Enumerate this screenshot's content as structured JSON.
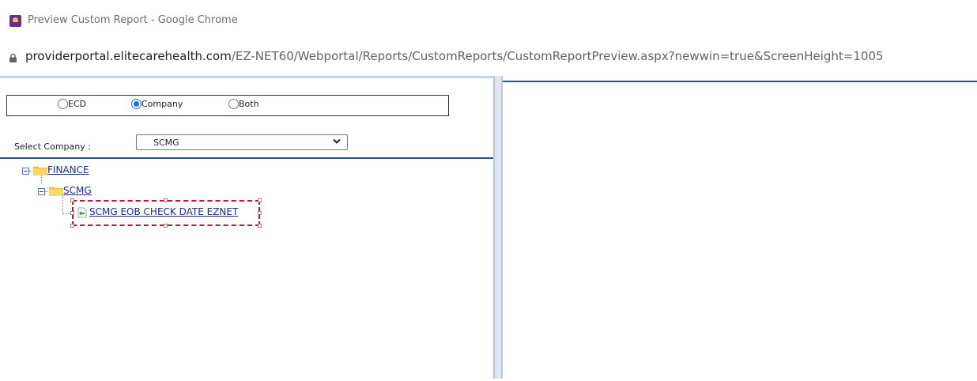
{
  "window": {
    "title": "Preview Custom Report - Google Chrome",
    "icon": "app-icon"
  },
  "addressbar": {
    "host": "providerportal.elitecarehealth.com",
    "path": "/EZ-NET60/Webportal/Reports/CustomReports/CustomReportPreview.aspx?newwin=true&ScreenHeight=1005",
    "icon": "lock-icon"
  },
  "filter": {
    "options": [
      {
        "label": "ECD",
        "checked": false
      },
      {
        "label": "Company",
        "checked": true
      },
      {
        "label": "Both",
        "checked": false
      }
    ]
  },
  "company_select": {
    "label": "Select Company :",
    "value": "SCMG"
  },
  "tree": {
    "root": {
      "label": "FINANCE",
      "icon": "folder-icon"
    },
    "child": {
      "label": "SCMG",
      "icon": "folder-icon"
    },
    "leaf": {
      "label": "SCMG EOB CHECK DATE EZNET",
      "icon": "report-icon",
      "selected": true
    }
  },
  "colors": {
    "frame_line": "#2d4f8a",
    "link": "#1a2d8a",
    "selection": "#c8102e",
    "radio_checked": "#1a73e8"
  }
}
